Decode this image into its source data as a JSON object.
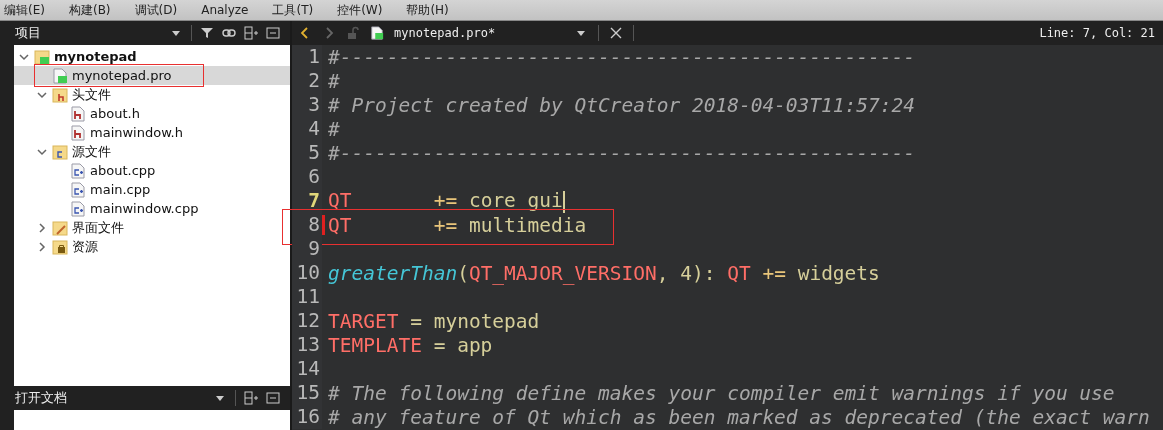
{
  "menu": [
    "编辑(E)",
    "构建(B)",
    "调试(D)",
    "Analyze",
    "工具(T)",
    "控件(W)",
    "帮助(H)"
  ],
  "sidebar": {
    "title": "项目",
    "tree": [
      {
        "label": "mynotepad",
        "kind": "project",
        "expanded": true,
        "selected": false,
        "children": [
          {
            "label": "mynotepad.pro",
            "kind": "pro",
            "selected": true,
            "annotated": true
          },
          {
            "label": "头文件",
            "kind": "header-folder",
            "expanded": true,
            "selected": false,
            "children": [
              {
                "label": "about.h",
                "kind": "header",
                "selected": false
              },
              {
                "label": "mainwindow.h",
                "kind": "header",
                "selected": false
              }
            ]
          },
          {
            "label": "源文件",
            "kind": "source-folder",
            "expanded": true,
            "selected": false,
            "children": [
              {
                "label": "about.cpp",
                "kind": "source",
                "selected": false
              },
              {
                "label": "main.cpp",
                "kind": "source",
                "selected": false
              },
              {
                "label": "mainwindow.cpp",
                "kind": "source",
                "selected": false
              }
            ]
          },
          {
            "label": "界面文件",
            "kind": "forms-folder",
            "expanded": false,
            "selected": false
          },
          {
            "label": "资源",
            "kind": "resources-folder",
            "expanded": false,
            "selected": false
          }
        ]
      }
    ],
    "open_documents_title": "打开文档"
  },
  "editor": {
    "file_name": "mynotepad.pro*",
    "position": "Line: 7, Col: 21",
    "lines": [
      {
        "number": "1",
        "current": false,
        "tokens": [
          {
            "text": "#-------------------------------------------------",
            "kind": "comment"
          }
        ]
      },
      {
        "number": "2",
        "current": false,
        "tokens": [
          {
            "text": "#",
            "kind": "comment"
          }
        ]
      },
      {
        "number": "3",
        "current": false,
        "tokens": [
          {
            "text": "# Project created by QtCreator 2018-04-03T11:57:24",
            "kind": "comment"
          }
        ]
      },
      {
        "number": "4",
        "current": false,
        "tokens": [
          {
            "text": "#",
            "kind": "comment"
          }
        ]
      },
      {
        "number": "5",
        "current": false,
        "tokens": [
          {
            "text": "#-------------------------------------------------",
            "kind": "comment"
          }
        ]
      },
      {
        "number": "6",
        "current": false
      },
      {
        "number": "7",
        "current": true,
        "tokens": [
          {
            "text": "QT",
            "kind": "variable"
          },
          {
            "text": "       +=",
            "kind": "operator"
          },
          {
            "text": " core gui",
            "kind": "plain"
          }
        ]
      },
      {
        "number": "8",
        "current": false,
        "changed": true,
        "annotated": true,
        "tokens": [
          {
            "text": "QT",
            "kind": "variable"
          },
          {
            "text": "       +=",
            "kind": "operator"
          },
          {
            "text": " multimedia",
            "kind": "plain"
          }
        ]
      },
      {
        "number": "9",
        "current": false
      },
      {
        "number": "10",
        "current": false,
        "tokens": [
          {
            "text": "greaterThan",
            "kind": "function"
          },
          {
            "text": "(",
            "kind": "punct"
          },
          {
            "text": "QT_MAJOR_VERSION",
            "kind": "variable"
          },
          {
            "text": ", 4): ",
            "kind": "punct"
          },
          {
            "text": "QT",
            "kind": "variable"
          },
          {
            "text": " +=",
            "kind": "operator"
          },
          {
            "text": " widgets",
            "kind": "plain"
          }
        ]
      },
      {
        "number": "11",
        "current": false
      },
      {
        "number": "12",
        "current": false,
        "tokens": [
          {
            "text": "TARGET",
            "kind": "variable"
          },
          {
            "text": " = mynotepad",
            "kind": "plain"
          }
        ]
      },
      {
        "number": "13",
        "current": false,
        "tokens": [
          {
            "text": "TEMPLATE",
            "kind": "variable"
          },
          {
            "text": " = app",
            "kind": "plain"
          }
        ]
      },
      {
        "number": "14",
        "current": false
      },
      {
        "number": "15",
        "current": false,
        "tokens": [
          {
            "text": "# The following define makes your compiler emit warnings if you use",
            "kind": "comment"
          }
        ]
      },
      {
        "number": "16",
        "current": false,
        "tokens": [
          {
            "text": "# any feature of Qt which as been marked as deprecated (the exact warn",
            "kind": "comment"
          }
        ]
      }
    ]
  }
}
